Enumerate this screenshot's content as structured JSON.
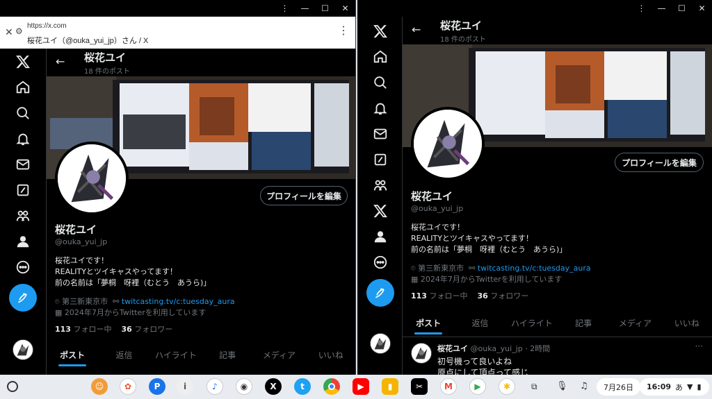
{
  "left_window": {
    "titlebar_icons": [
      "⋮",
      "—",
      "☐",
      "✕"
    ],
    "url": "https://x.com",
    "page_title": "桜花ユイ（@ouka_yui_jp）さん / X",
    "header": {
      "name": "桜花ユイ",
      "post_count": "18 件のポスト"
    },
    "profile": {
      "edit_label": "プロフィールを編集",
      "name": "桜花ユイ",
      "handle": "@ouka_yui_jp",
      "bio_lines": [
        "桜花ユイです！",
        "REALITYとツイキャスやってます！",
        "前の名前は「夢桐　呀裡（むとう　あうら)」"
      ],
      "location": "第三新東京市",
      "link": "twitcasting.tv/c:tuesday_aura",
      "joined": "2024年7月からTwitterを利用しています",
      "following_count": "113",
      "following_label": "フォロー中",
      "followers_count": "36",
      "followers_label": "フォロワー"
    },
    "tabs": [
      "ポスト",
      "返信",
      "ハイライト",
      "記事",
      "メディア",
      "いいね"
    ]
  },
  "right_window": {
    "titlebar_icons": [
      "⋮",
      "—",
      "☐",
      "✕"
    ],
    "header": {
      "name": "桜花ユイ",
      "post_count": "18 件のポスト"
    },
    "profile": {
      "edit_label": "プロフィールを編集",
      "name": "桜花ユイ",
      "handle": "@ouka_yui_jp",
      "bio_lines": [
        "桜花ユイです！",
        "REALITYとツイキャスやってます！",
        "前の名前は「夢桐　呀裡（むとう　あうら)」"
      ],
      "location": "第三新東京市",
      "link": "twitcasting.tv/c:tuesday_aura",
      "joined": "2024年7月からTwitterを利用しています",
      "following_count": "113",
      "following_label": "フォロー中",
      "followers_count": "36",
      "followers_label": "フォロワー"
    },
    "tabs": [
      "ポスト",
      "返信",
      "ハイライト",
      "記事",
      "メディア",
      "いいね"
    ],
    "tweet": {
      "name": "桜花ユイ",
      "handle_time": "@ouka_yui_jp · 2時間",
      "more": "···",
      "line1": "初号機って良いよね",
      "line2": "原点にして頂点って感じ"
    }
  },
  "shelf": {
    "date": "7月26日",
    "time": "16:09",
    "ime": "あ"
  },
  "colors": {
    "accent": "#1d9bf0",
    "background": "#000000",
    "secondary_text": "#71767b"
  }
}
